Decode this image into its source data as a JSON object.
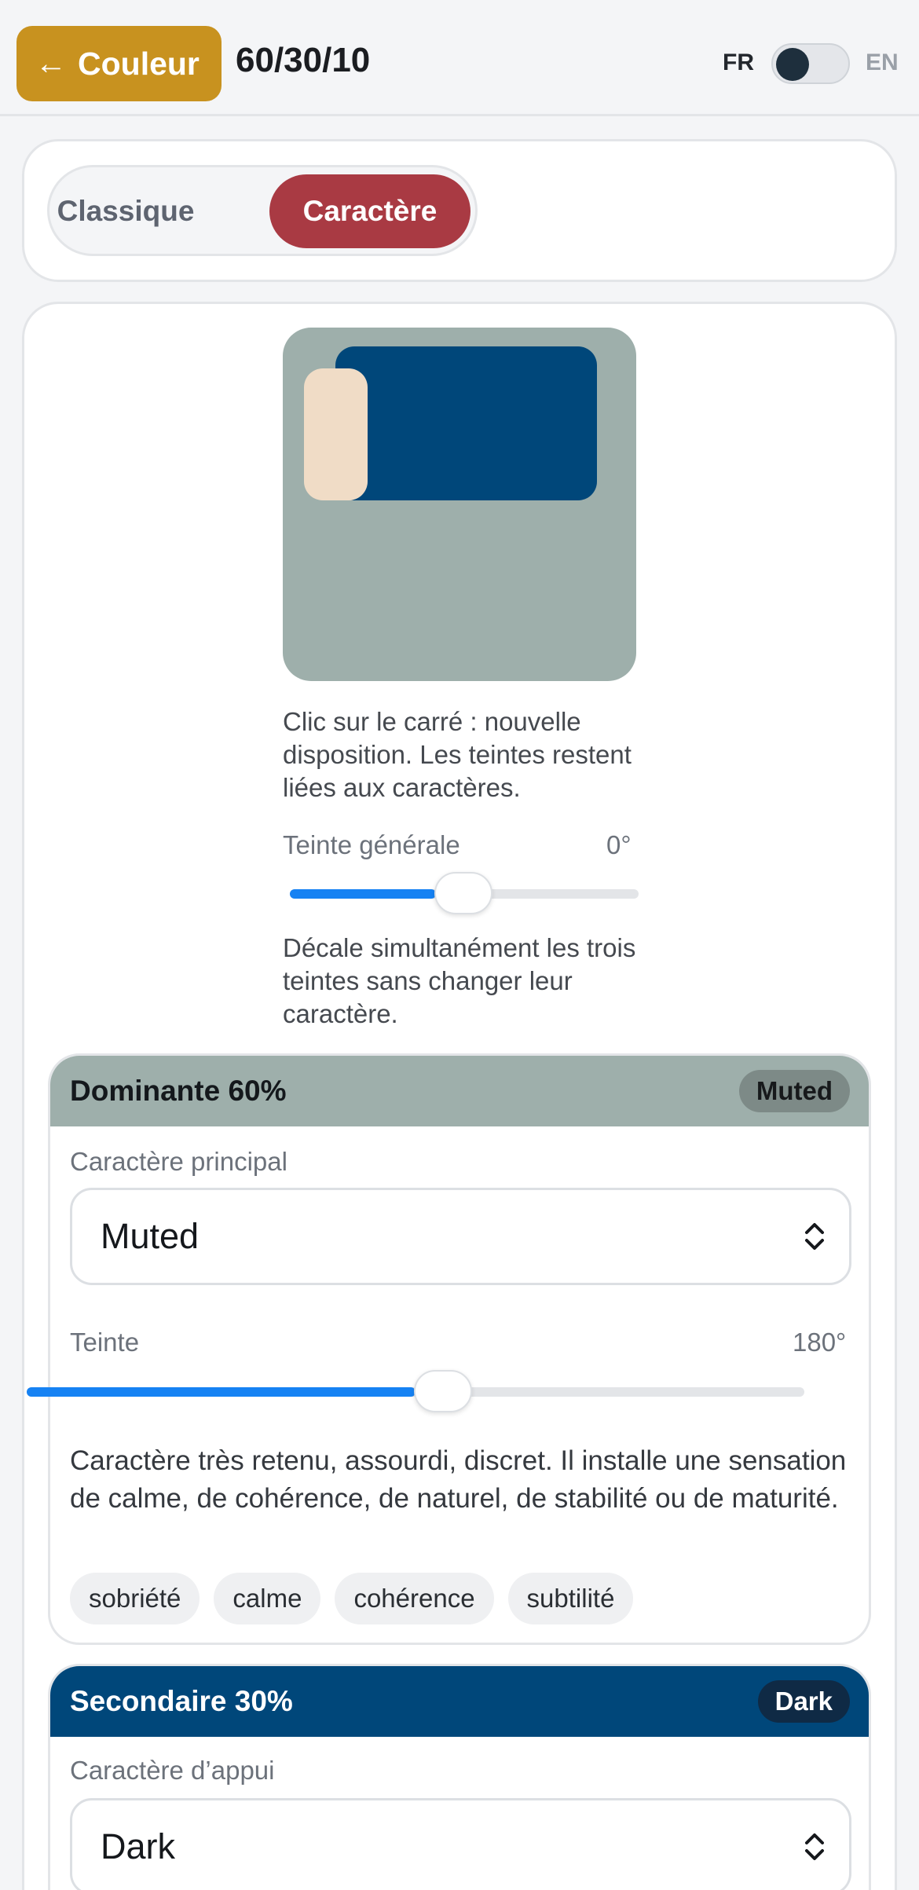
{
  "header": {
    "back_label": "Couleur",
    "back_icon": "arrow-left-icon",
    "title": "60/30/10",
    "lang_left": "FR",
    "lang_right": "EN"
  },
  "mode": {
    "options": [
      "Classique",
      "Caractère"
    ],
    "selected": "Caractère"
  },
  "preview": {
    "colors": {
      "dominant": "#9eafab",
      "secondary": "#00477a",
      "accent": "#f0dcc6"
    },
    "hint": "Clic sur le carré : nouvelle disposition. Les teintes restent liées aux caractères."
  },
  "global_hue": {
    "label": "Teinte générale",
    "value": "0°",
    "level": 0.42,
    "hint": "Décale simultanément les trois teintes sans changer leur caractère."
  },
  "dominant": {
    "title": "Dominante 60%",
    "badge": "Muted",
    "field_label": "Caractère principal",
    "selected": "Muted",
    "hue_label": "Teinte",
    "hue_value": "180°",
    "hue_level": 0.5,
    "description": "Caractère très retenu, assourdi, discret. Il installe une sensation de calme, de cohérence, de naturel, de stabilité ou de maturité.",
    "tags": [
      "sobriété",
      "calme",
      "cohérence",
      "subtilité"
    ],
    "color": "#9eafab"
  },
  "secondary": {
    "title": "Secondaire 30%",
    "badge": "Dark",
    "field_label": "Caractère d’appui",
    "selected": "Dark",
    "color": "#00477a"
  },
  "accent_colors": {
    "back_button": "#c8921f",
    "active_segment": "#a93a43",
    "slider_fill": "#1682f3"
  }
}
